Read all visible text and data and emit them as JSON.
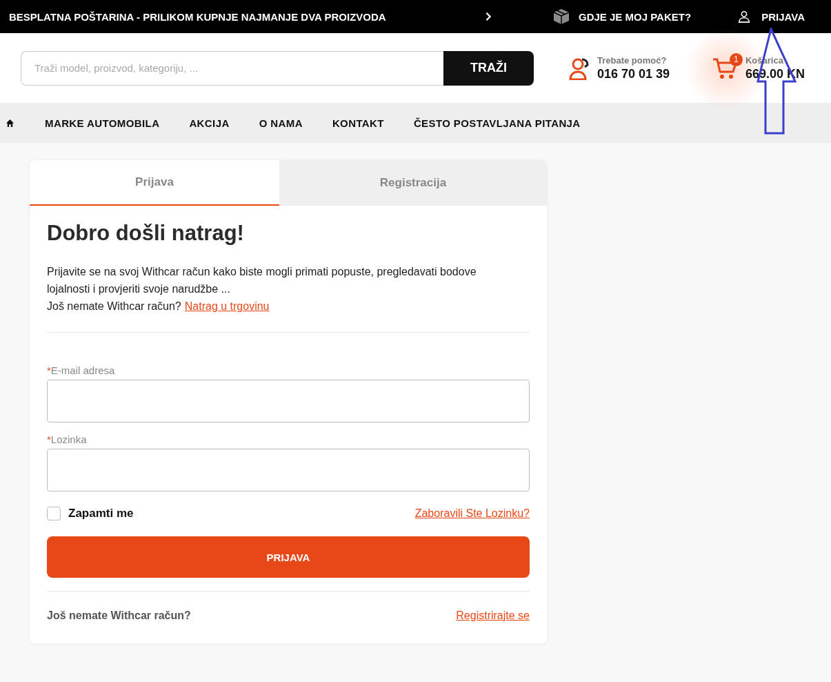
{
  "top_bar": {
    "promo": "BESPLATNA POŠTARINA - PRILIKOM KUPNJE NAJMANJE DVA PROIZVODA",
    "track_link": "GDJE JE MOJ PAKET?",
    "login_link": "PRIJAVA"
  },
  "header": {
    "search": {
      "placeholder": "Traži model, proizvod, kategoriju, ...",
      "button": "TRAŽI"
    },
    "help": {
      "label": "Trebate pomoć?",
      "phone": "016 70 01 39"
    },
    "cart": {
      "count": "1",
      "label": "Košarica",
      "total": "669.00 KN"
    }
  },
  "nav": {
    "items": [
      "MARKE AUTOMOBILA",
      "AKCIJA",
      "O NAMA",
      "KONTAKT",
      "ČESTO POSTAVLJANA PITANJA"
    ]
  },
  "tabs": [
    {
      "label": "Prijava",
      "selected": true
    },
    {
      "label": "Registracija",
      "selected": false
    }
  ],
  "login": {
    "title": "Dobro došli natrag!",
    "intro": "Prijavite se na svoj Withcar račun kako biste mogli primati popuste, pregledavati bodove lojalnosti i provjeriti svoje narudžbe ...",
    "no_account_text": "Još nemate Withcar račun?",
    "back_link": "Natrag u trgovinu",
    "fields": [
      {
        "marker": "*",
        "label": "E-mail adresa"
      },
      {
        "marker": "*",
        "label": "Lozinka"
      }
    ],
    "remember": {
      "label": "Zapamti me",
      "checked": false
    },
    "forgot_link": "Zaboravili Ste Lozinku?",
    "submit": "PRIJAVA",
    "footer": {
      "text": "Još nemate Withcar račun?",
      "link": "Registrirajte se"
    }
  },
  "annotations": [
    {
      "kind": "arrow-up"
    }
  ]
}
